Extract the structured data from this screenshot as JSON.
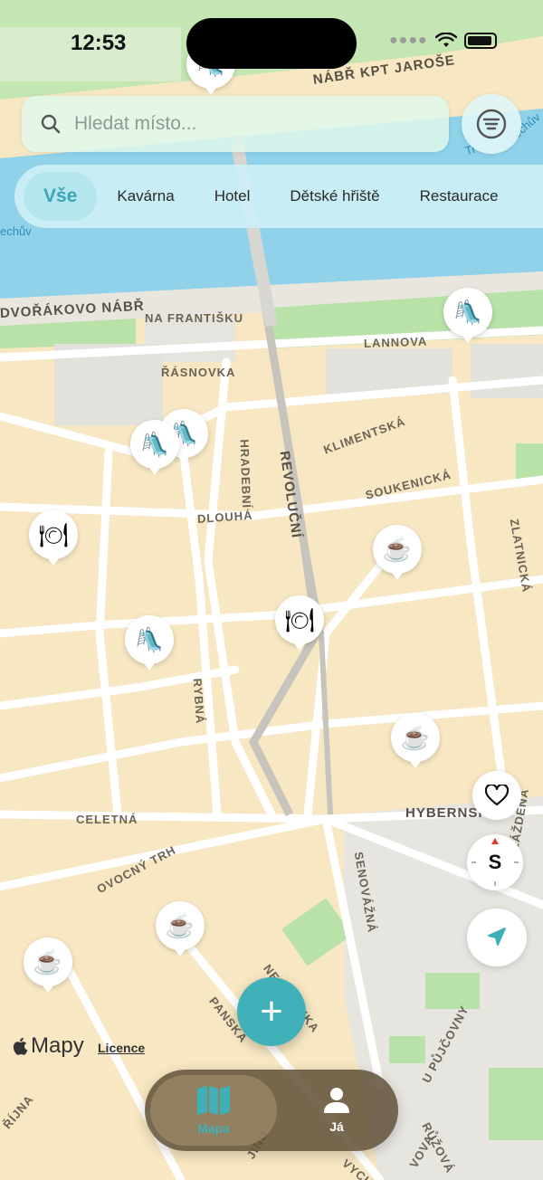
{
  "status_bar": {
    "time": "12:53"
  },
  "search": {
    "placeholder": "Hledat místo..."
  },
  "categories": [
    {
      "label": "Vše",
      "active": true
    },
    {
      "label": "Kavárna"
    },
    {
      "label": "Hotel"
    },
    {
      "label": "Dětské hřiště"
    },
    {
      "label": "Restaurace"
    }
  ],
  "map": {
    "streets": {
      "nabr_kpt_jarose": "NÁBŘ KPT JAROŠE",
      "dvorakovo_nabr": "DVOŘÁKOVO NÁBŘ",
      "na_frantisku": "NA FRANTIŠKU",
      "lannova": "LANNOVA",
      "rasnovka": "ŘÁSNOVKA",
      "klimentska": "KLIMENTSKÁ",
      "hradebni": "HRADEBNÍ",
      "revolucni": "REVOLUČNÍ",
      "soukenicka": "SOUKENICKÁ",
      "dlouha": "DLOUHÁ",
      "zlatnicka": "ZLATNICKÁ",
      "rybna": "RYBNÁ",
      "celetna": "CELETNÁ",
      "hybernska": "HYBERNSKÁ",
      "ovocny_trh": "OVOCNÝ TRH",
      "senovazna": "SENOVÁŽNÁ",
      "dlazdena": "DLÁŽDĚNÁ",
      "nekazanka": "NEKÁZANKA",
      "panska": "PANSKÁ",
      "u_pujcovny": "U PŮJČOVNY",
      "ruzova": "RŮŽOVÁ",
      "rijna": "ŘÍJNA",
      "jind": "JIND",
      "vych": "VYCH",
      "vova": "VOVA"
    },
    "water_labels": {
      "right": "Tr",
      "cechuv_right": "Čechův",
      "cechuv_left": "echův"
    },
    "pins": [
      {
        "type": "playground",
        "glyph": "🛝"
      },
      {
        "type": "playground",
        "glyph": "🛝"
      },
      {
        "type": "playground",
        "glyph": "🛝"
      },
      {
        "type": "playground",
        "glyph": "🛝"
      },
      {
        "type": "playground",
        "glyph": "🛝"
      },
      {
        "type": "restaurant",
        "glyph": "🍽"
      },
      {
        "type": "restaurant",
        "glyph": "🍽"
      },
      {
        "type": "cafe",
        "glyph": "☕"
      },
      {
        "type": "cafe",
        "glyph": "☕"
      },
      {
        "type": "cafe",
        "glyph": "☕"
      },
      {
        "type": "cafe",
        "glyph": "☕"
      }
    ]
  },
  "controls": {
    "compass_letter": "S"
  },
  "attribution": {
    "maps_brand": "Mapy",
    "licence": "Licence"
  },
  "tabs": [
    {
      "label": "Mapa",
      "icon": "map-icon",
      "active": true
    },
    {
      "label": "Já",
      "icon": "person-icon"
    }
  ],
  "colors": {
    "accent": "#3fb0b7",
    "water": "#8fd2ea",
    "park": "#b9e2a8",
    "land": "#f7e7c2"
  }
}
